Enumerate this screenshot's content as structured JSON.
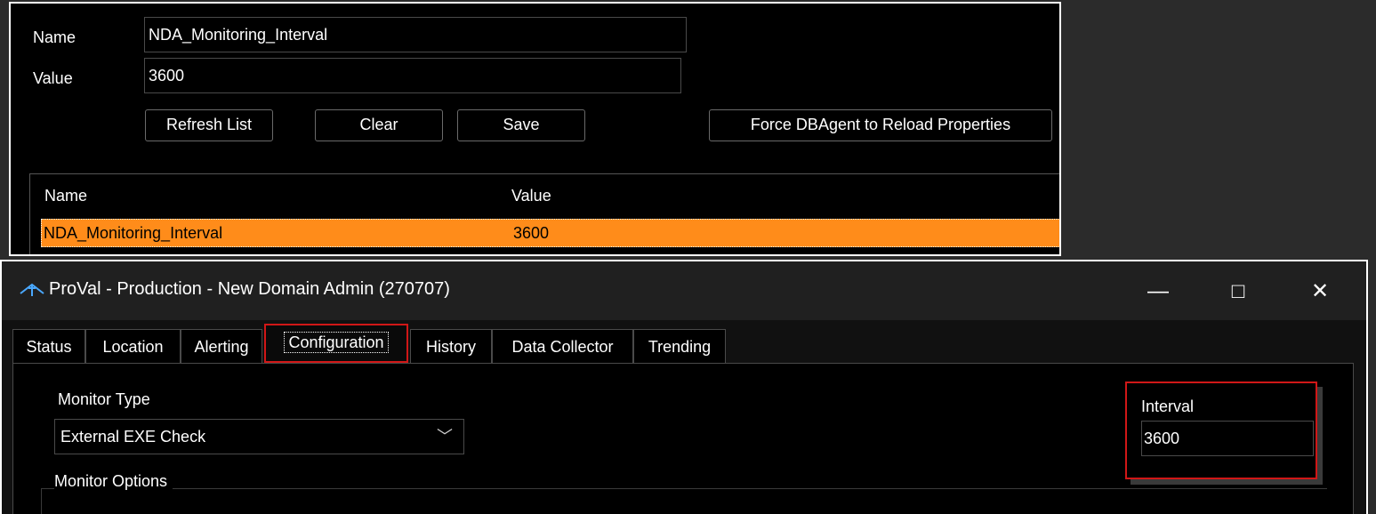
{
  "top_panel": {
    "name_label": "Name",
    "name_value": "NDA_Monitoring_Interval",
    "value_label": "Value",
    "value_value": "3600",
    "buttons": {
      "refresh": "Refresh List",
      "clear": "Clear",
      "save": "Save",
      "force": "Force DBAgent to Reload Properties"
    },
    "grid": {
      "columns": [
        "Name",
        "Value"
      ],
      "rows": [
        {
          "name": "NDA_Monitoring_Interval",
          "value": "3600"
        }
      ]
    }
  },
  "window": {
    "title": "ProVal - Production - New Domain Admin (270707)",
    "controls": {
      "minimize": "—",
      "maximize": "□",
      "close": "✕"
    },
    "tabs": [
      "Status",
      "Location",
      "Alerting",
      "Configuration",
      "History",
      "Data Collector",
      "Trending"
    ],
    "active_tab": "Configuration",
    "monitor_type_label": "Monitor Type",
    "monitor_type_value": "External EXE Check",
    "monitor_options_label": "Monitor Options",
    "interval_label": "Interval",
    "interval_value": "3600"
  },
  "colors": {
    "selected_row": "#ff8c1a",
    "highlight_border": "#d01717",
    "background": "#000000"
  },
  "icons": {
    "app_icon": "proval-app-icon",
    "dropdown": "chevron-down-icon"
  }
}
